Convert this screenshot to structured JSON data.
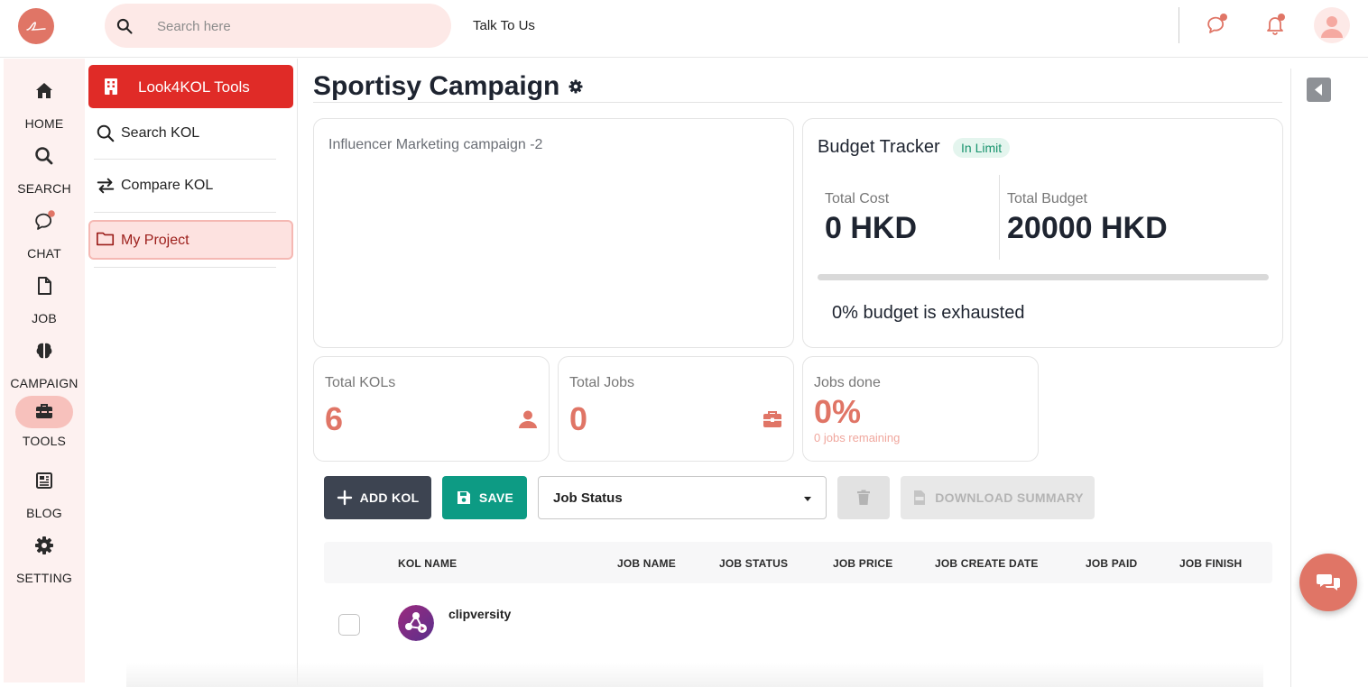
{
  "header": {
    "search_placeholder": "Search here",
    "talk_link": "Talk To Us",
    "icons": [
      "logo-icon",
      "search-icon",
      "chat-icon",
      "bell-icon",
      "user-avatar-icon"
    ],
    "accent_color": "#e07566"
  },
  "rail": {
    "items": [
      {
        "label": "HOME",
        "icon": "home-icon"
      },
      {
        "label": "SEARCH",
        "icon": "search-icon"
      },
      {
        "label": "CHAT",
        "icon": "chat-icon"
      },
      {
        "label": "JOB",
        "icon": "document-icon"
      },
      {
        "label": "CAMPAIGN",
        "icon": "brain-icon"
      },
      {
        "label": "TOOLS",
        "icon": "toolbox-icon"
      },
      {
        "label": "BLOG",
        "icon": "newspaper-icon"
      },
      {
        "label": "SETTING",
        "icon": "gear-icon"
      }
    ],
    "active": "TOOLS"
  },
  "tools": {
    "title": "Look4KOL Tools",
    "items": [
      {
        "label": "Search KOL",
        "icon": "search-icon"
      },
      {
        "label": "Compare KOL",
        "icon": "arrows-exchange-icon"
      },
      {
        "label": "My Project",
        "icon": "folder-icon"
      }
    ],
    "active": "My Project"
  },
  "main": {
    "title": "Sportisy Campaign",
    "description": "Influencer Marketing campaign -2",
    "budget": {
      "title": "Budget Tracker",
      "status": "In Limit",
      "cost_label": "Total Cost",
      "cost_value": "0 HKD",
      "total_label": "Total Budget",
      "total_value": "20000 HKD",
      "progress": 0,
      "exhausted_text": "0% budget is exhausted"
    },
    "stats": [
      {
        "label": "Total KOLs",
        "value": "6",
        "icon": "user-icon"
      },
      {
        "label": "Total Jobs",
        "value": "0",
        "icon": "briefcase-icon"
      },
      {
        "label": "Jobs done",
        "value": "0%",
        "sub": "0 jobs remaining"
      }
    ],
    "actions": {
      "add_kol": "ADD KOL",
      "save": "SAVE",
      "job_status": "Job Status",
      "download": "DOWNLOAD SUMMARY"
    },
    "table": {
      "columns": [
        "KOL NAME",
        "JOB NAME",
        "JOB STATUS",
        "JOB PRICE",
        "JOB CREATE DATE",
        "JOB PAID",
        "JOB FINISH"
      ],
      "rows": [
        {
          "kol_name": "clipversity"
        }
      ]
    }
  }
}
